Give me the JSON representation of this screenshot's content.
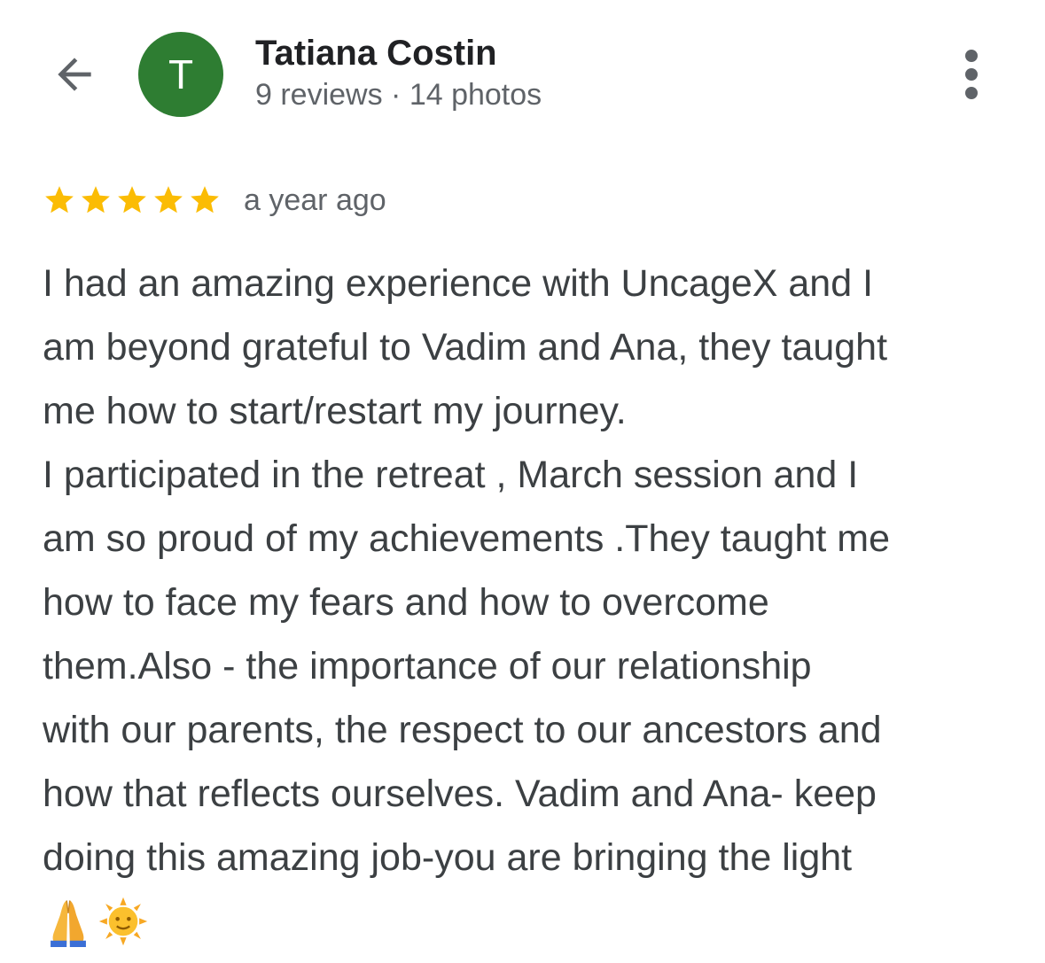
{
  "reviewer": {
    "avatar_initial": "T",
    "name": "Tatiana Costin",
    "meta": "9 reviews · 14 photos"
  },
  "review": {
    "rating": 5,
    "rating_max": 5,
    "time": "a year ago",
    "lines": [
      "I had an amazing experience with UncageX and I",
      "am beyond grateful to Vadim and Ana, they taught",
      "me how to start/restart my journey.",
      "I participated in the retreat , March session and I",
      "am so proud of my achievements .They taught me",
      "how to face my fears and how to overcome",
      "them.Also - the importance of our relationship",
      "with our parents, the respect to our ancestors and",
      "how that reflects ourselves. Vadim and Ana- keep",
      "doing this amazing job-you are bringing the light"
    ],
    "emojis": [
      "folded-hands-emoji",
      "sun-with-face-emoji"
    ]
  },
  "icons": {
    "back": "back-arrow-icon",
    "menu": "more-vertical-icon",
    "star": "star-icon"
  },
  "colors": {
    "avatar_bg": "#2e7d32",
    "star": "#fbbc04",
    "icon": "#5f6368",
    "name": "#202124",
    "text": "#3c4043",
    "secondary": "#5f6368"
  }
}
